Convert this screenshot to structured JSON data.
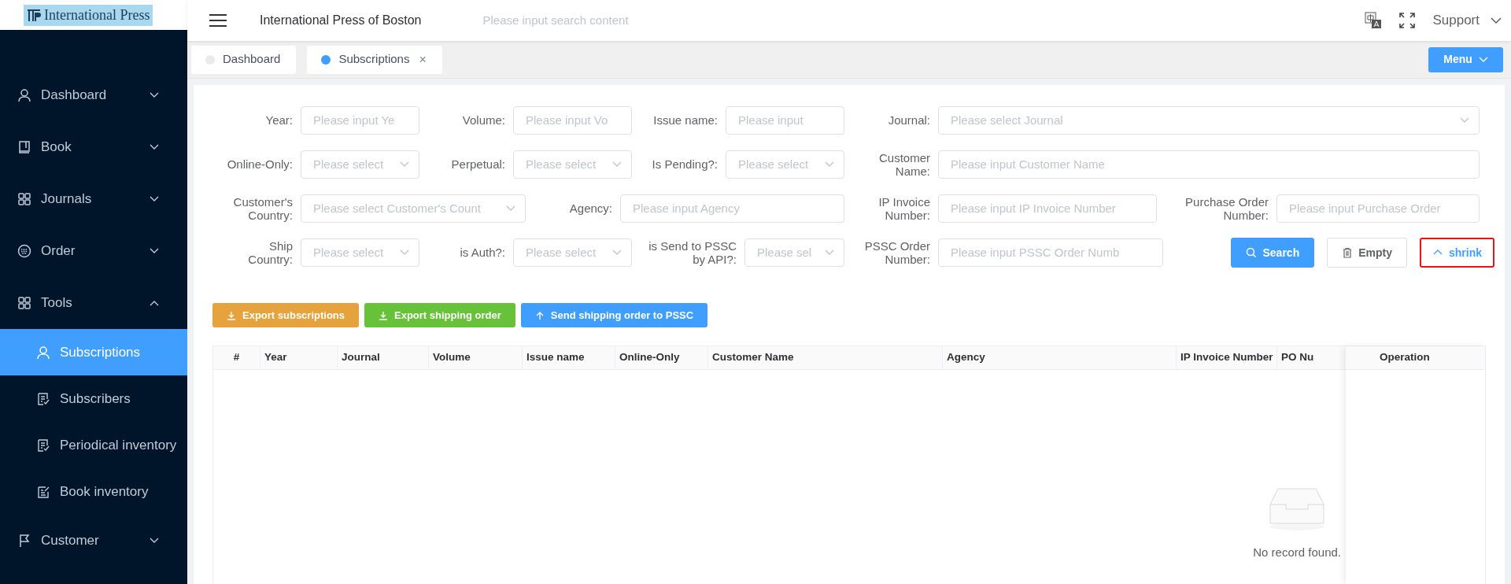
{
  "logo": {
    "text": "International Press"
  },
  "sidebar": {
    "items": [
      {
        "label": "Dashboard",
        "expanded": false
      },
      {
        "label": "Book",
        "expanded": false
      },
      {
        "label": "Journals",
        "expanded": false
      },
      {
        "label": "Order",
        "expanded": false
      },
      {
        "label": "Tools",
        "expanded": true,
        "children": [
          {
            "label": "Subscriptions",
            "selected": true
          },
          {
            "label": "Subscribers",
            "selected": false
          },
          {
            "label": "Periodical inventory",
            "selected": false
          },
          {
            "label": "Book inventory",
            "selected": false
          }
        ]
      },
      {
        "label": "Customer",
        "expanded": false
      }
    ]
  },
  "header": {
    "title": "International Press of Boston",
    "search": {
      "placeholder": "Please input search content"
    },
    "user_menu": "Support"
  },
  "tabs": [
    {
      "label": "Dashboard",
      "selected": false
    },
    {
      "label": "Subscriptions",
      "selected": true,
      "close_glyph": "×"
    }
  ],
  "menu_button": "Menu",
  "filters": {
    "fields": [
      {
        "label": "Year:",
        "kind": "input",
        "placeholder": "Please input Ye"
      },
      {
        "label": "Volume:",
        "kind": "input",
        "placeholder": "Please input Vo"
      },
      {
        "label": "Issue name:",
        "kind": "input",
        "placeholder": "Please input"
      },
      {
        "label": "Journal:",
        "kind": "select",
        "placeholder": "Please select Journal"
      },
      {
        "label": "Online-Only:",
        "kind": "select",
        "placeholder": "Please select"
      },
      {
        "label": "Perpetual:",
        "kind": "select",
        "placeholder": "Please select"
      },
      {
        "label": "Is Pending?:",
        "kind": "select",
        "placeholder": "Please select"
      },
      {
        "label": "Customer Name:",
        "kind": "input",
        "placeholder": "Please input Customer Name"
      },
      {
        "label": "Customer's Country:",
        "kind": "select",
        "placeholder": "Please select Customer's Count"
      },
      {
        "label": "Agency:",
        "kind": "input",
        "placeholder": "Please input Agency"
      },
      {
        "label": "IP Invoice Number:",
        "kind": "input",
        "placeholder": "Please input IP Invoice Number"
      },
      {
        "label": "Purchase Order Number:",
        "kind": "input",
        "placeholder": "Please input Purchase Order"
      },
      {
        "label": "Ship Country:",
        "kind": "select",
        "placeholder": "Please select"
      },
      {
        "label": "is Auth?:",
        "kind": "select",
        "placeholder": "Please select"
      },
      {
        "label": "is Send to PSSC by API?:",
        "kind": "select",
        "placeholder": "Please sel"
      },
      {
        "label": "PSSC Order Number:",
        "kind": "input",
        "placeholder": "Please input PSSC Order Numb"
      }
    ],
    "buttons": [
      {
        "label": "Search",
        "kind": "primary",
        "highlighted": false
      },
      {
        "label": "Empty",
        "kind": "default",
        "highlighted": false
      },
      {
        "label": "shrink",
        "kind": "text",
        "highlighted": true
      }
    ]
  },
  "actions": [
    {
      "label": "Export subscriptions",
      "color": "#e6a23c"
    },
    {
      "label": "Export shipping order",
      "color": "#67c23a"
    },
    {
      "label": "Send shipping order to PSSC",
      "color": "#409eff"
    }
  ],
  "table": {
    "columns": [
      "#",
      "Year",
      "Journal",
      "Volume",
      "Issue name",
      "Online-Only",
      "Customer Name",
      "Agency",
      "IP Invoice Number",
      "PO Nu"
    ],
    "fixed_column": "Operation",
    "empty_text": "No record found."
  }
}
